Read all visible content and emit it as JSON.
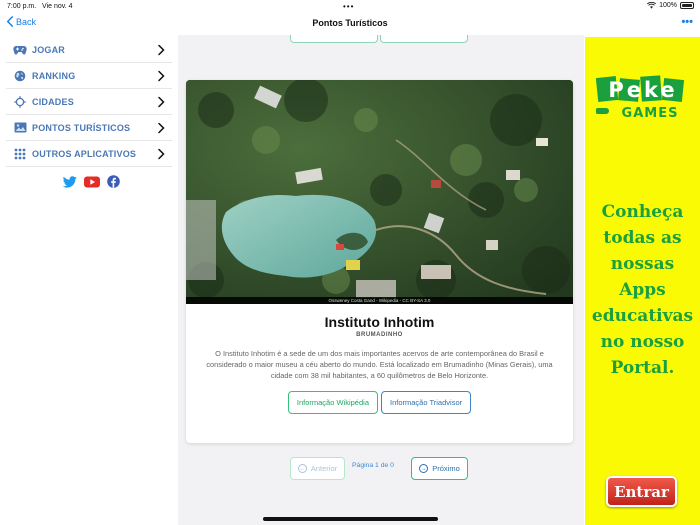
{
  "status": {
    "time": "7:00 p.m.",
    "date": "Vie nov. 4",
    "battery": "100%"
  },
  "nav": {
    "back": "Back",
    "title": "Pontos Turísticos"
  },
  "sidebar": {
    "items": [
      {
        "label": "JOGAR",
        "icon": "gamepad-icon"
      },
      {
        "label": "RANKING",
        "icon": "globe-icon"
      },
      {
        "label": "CIDADES",
        "icon": "crosshair-icon"
      },
      {
        "label": "PONTOS TURÍSTICOS",
        "icon": "image-icon"
      },
      {
        "label": "OUTROS APLICATIVOS",
        "icon": "grid-icon"
      }
    ],
    "social": [
      "twitter-icon",
      "youtube-icon",
      "facebook-icon"
    ]
  },
  "card": {
    "photo_credit": "Ossweney Costa Gand - Wikipedia - CC BY-SA 3.0",
    "title": "Instituto Inhotim",
    "subtitle": "BRUMADINHO",
    "description": "O Instituto Inhotim é a sede de um dos mais importantes acervos de arte contemporânea do Brasil e considerado o maior museu a céu aberto do mundo. Está localizado em Brumadinho (Minas Gerais), uma cidade com 38 mil habitantes, a 60 quilômetros de Belo Horizonte.",
    "btn_wiki": "Informação Wikipédia",
    "btn_trip": "Informação Triadvisor"
  },
  "pager": {
    "prev": "Anterior",
    "info": "Página 1 de 0",
    "next": "Próximo"
  },
  "ad": {
    "logo_top": "Peke",
    "logo_bottom": "GAMES",
    "text_lines": [
      "Conheça",
      "todas as",
      "nossas Apps",
      "educativas",
      "no nosso",
      "Portal."
    ],
    "button": "Entrar"
  },
  "colors": {
    "accent": "#1a7ee8",
    "sidebar_label": "#4a78b6",
    "green": "#32c27a",
    "ad_bg": "#fafa04",
    "ad_text": "#1aa03c"
  }
}
